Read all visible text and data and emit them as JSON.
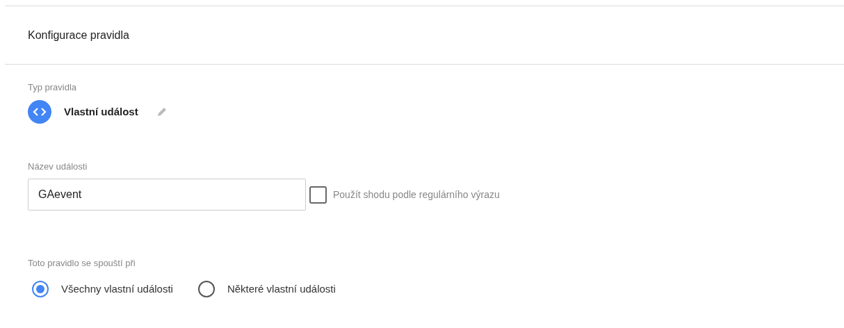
{
  "header": {
    "title": "Konfigurace pravidla"
  },
  "rule_type": {
    "label": "Typ pravidla",
    "value": "Vlastní událost"
  },
  "event_name": {
    "label": "Název události",
    "value": "GAevent",
    "regex": {
      "label": "Použít shodu podle regulárního výrazu",
      "checked": false
    }
  },
  "fires_on": {
    "label": "Toto pravidlo se spouští při",
    "options": [
      {
        "label": "Všechny vlastní události",
        "selected": true
      },
      {
        "label": "Některé vlastní události",
        "selected": false
      }
    ]
  }
}
